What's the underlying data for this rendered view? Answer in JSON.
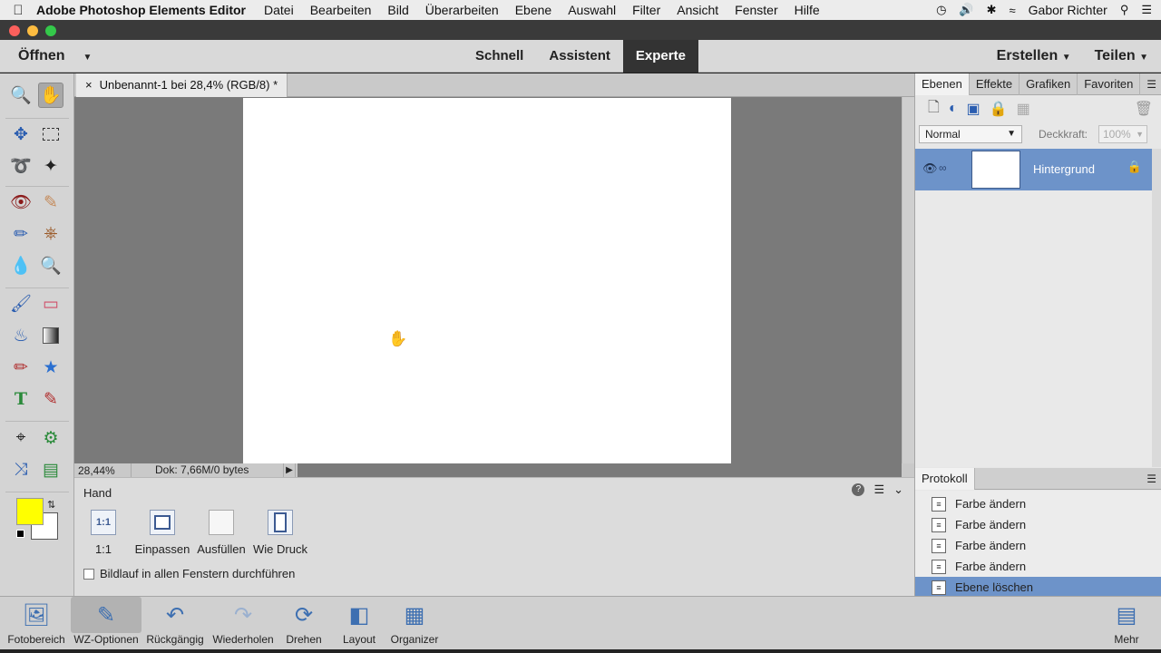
{
  "menubar": {
    "app_name": "Adobe Photoshop Elements Editor",
    "items": [
      "Datei",
      "Bearbeiten",
      "Bild",
      "Überarbeiten",
      "Ebene",
      "Auswahl",
      "Filter",
      "Ansicht",
      "Fenster",
      "Hilfe"
    ],
    "user": "Gabor Richter"
  },
  "modebar": {
    "open_label": "Öffnen",
    "modes": [
      "Schnell",
      "Assistent",
      "Experte"
    ],
    "active_mode": "Experte",
    "create_label": "Erstellen",
    "share_label": "Teilen"
  },
  "document": {
    "tab_title": "Unbenannt-1 bei 28,4% (RGB/8) *",
    "zoom": "28,44%",
    "doc_info": "Dok: 7,66M/0 bytes"
  },
  "tool_options": {
    "title": "Hand",
    "buttons": [
      {
        "icon_text": "1:1",
        "label": "1:1"
      },
      {
        "icon_text": "",
        "label": "Einpassen"
      },
      {
        "icon_text": "",
        "label": "Ausfüllen"
      },
      {
        "icon_text": "",
        "label": "Wie Druck"
      }
    ],
    "checkbox_label": "Bildlauf in allen Fenstern durchführen"
  },
  "layers_panel": {
    "tabs": [
      "Ebenen",
      "Effekte",
      "Grafiken",
      "Favoriten"
    ],
    "blend_mode": "Normal",
    "opacity_label": "Deckkraft:",
    "opacity_value": "100%",
    "layer_name": "Hintergrund"
  },
  "history_panel": {
    "tab": "Protokoll",
    "items": [
      "Farbe ändern",
      "Farbe ändern",
      "Farbe ändern",
      "Farbe ändern",
      "Ebene löschen"
    ]
  },
  "bottombar": {
    "items": [
      "Fotobereich",
      "WZ-Optionen",
      "Rückgängig",
      "Wiederholen",
      "Drehen",
      "Layout",
      "Organizer"
    ],
    "more_label": "Mehr"
  },
  "colors": {
    "foreground": "#ffff00",
    "background": "#ffffff",
    "selection": "#6d93c9"
  }
}
